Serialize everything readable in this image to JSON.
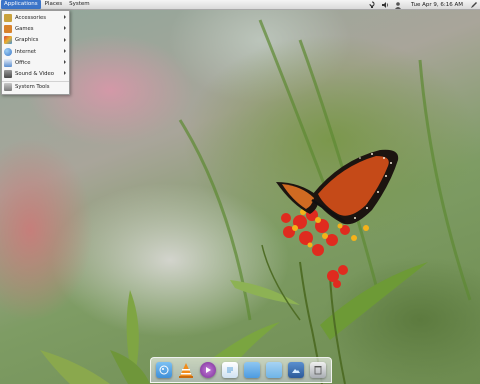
{
  "top_panel": {
    "menus": [
      "Applications",
      "Places",
      "System"
    ],
    "active_menu": "Applications",
    "clock": "Tue Apr 9,  6:16 AM",
    "tray_icons": [
      "network-icon",
      "volume-icon",
      "user-icon",
      "pen-icon"
    ]
  },
  "applications_menu": {
    "items": [
      {
        "label": "Accessories",
        "icon": "accessories-icon",
        "color": "#c9a23c",
        "submenu": true
      },
      {
        "label": "Games",
        "icon": "games-icon",
        "color": "#d8822b",
        "submenu": true
      },
      {
        "label": "Graphics",
        "icon": "graphics-icon",
        "color": "#d8443a",
        "submenu": true
      },
      {
        "label": "Internet",
        "icon": "internet-icon",
        "color": "#3e79c9",
        "submenu": true
      },
      {
        "label": "Office",
        "icon": "office-icon",
        "color": "#5c8fd0",
        "submenu": true
      },
      {
        "label": "Sound & Video",
        "icon": "sound-video-icon",
        "color": "#6a6a6a",
        "submenu": true
      },
      {
        "label": "System Tools",
        "icon": "system-tools-icon",
        "color": "#8a8a8a",
        "submenu": false
      }
    ]
  },
  "dock": {
    "items": [
      {
        "name": "finder-icon",
        "color": "#3f8fd8"
      },
      {
        "name": "vlc-icon",
        "color": "#f28c1a"
      },
      {
        "name": "media-player-icon",
        "color": "#9b4fb5"
      },
      {
        "name": "text-editor-icon",
        "color": "#5ba2d9"
      },
      {
        "name": "folder-icon",
        "color": "#4d9be0"
      },
      {
        "name": "home-folder-icon",
        "color": "#6fb4e6"
      },
      {
        "name": "image-viewer-icon",
        "color": "#3a6fb0"
      },
      {
        "name": "trash-icon",
        "color": "#b8bcc2"
      }
    ]
  }
}
